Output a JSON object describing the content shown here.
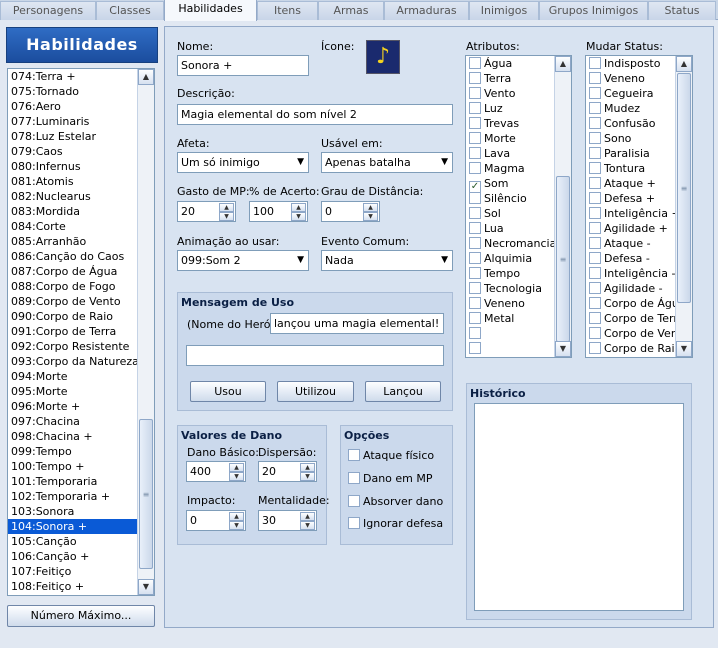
{
  "tabs": [
    "Personagens",
    "Classes",
    "Habilidades",
    "Itens",
    "Armas",
    "Armaduras",
    "Inimigos",
    "Grupos Inimigos",
    "Status"
  ],
  "active_tab": "Habilidades",
  "sidebar": {
    "title": "Habilidades",
    "items": [
      "074:Terra +",
      "075:Tornado",
      "076:Aero",
      "077:Luminaris",
      "078:Luz Estelar",
      "079:Caos",
      "080:Infernus",
      "081:Atomis",
      "082:Nuclearus",
      "083:Mordida",
      "084:Corte",
      "085:Arranhão",
      "086:Canção do Caos",
      "087:Corpo de Água",
      "088:Corpo de Fogo",
      "089:Corpo de Vento",
      "090:Corpo de Raio",
      "091:Corpo de Terra",
      "092:Corpo Resistente",
      "093:Corpo da Natureza",
      "094:Morte",
      "095:Morte",
      "096:Morte +",
      "097:Chacina",
      "098:Chacina +",
      "099:Tempo",
      "100:Tempo +",
      "101:Temporaria",
      "102:Temporaria +",
      "103:Sonora",
      "104:Sonora +",
      "105:Canção",
      "106:Canção +",
      "107:Feitiço",
      "108:Feitiço +"
    ],
    "selected": "104:Sonora +",
    "max_button": "Número Máximo..."
  },
  "form": {
    "nome_label": "Nome:",
    "nome_value": "Sonora +",
    "icone_label": "Ícone:",
    "icone_glyph": "♪",
    "descricao_label": "Descrição:",
    "descricao_value": "Magia elemental do som nível 2",
    "afeta_label": "Afeta:",
    "afeta_value": "Um só inimigo",
    "usavel_label": "Usável em:",
    "usavel_value": "Apenas batalha",
    "gasto_label": "Gasto de MP:",
    "gasto_value": "20",
    "acerto_label": "% de Acerto:",
    "acerto_value": "100",
    "distancia_label": "Grau de Distância:",
    "distancia_value": "0",
    "animacao_label": "Animação ao usar:",
    "animacao_value": "099:Som 2",
    "evento_label": "Evento Comum:",
    "evento_value": "Nada"
  },
  "mensagem": {
    "title": "Mensagem de Uso",
    "hero_label": "(Nome do Herói)",
    "line1": "lançou uma magia elemental!",
    "line2": "",
    "btn_usou": "Usou",
    "btn_utilizou": "Utilizou",
    "btn_lancou": "Lançou"
  },
  "dano": {
    "title": "Valores de Dano",
    "basico_label": "Dano Básico:",
    "basico_value": "400",
    "dispersao_label": "Dispersão:",
    "dispersao_value": "20",
    "impacto_label": "Impacto:",
    "impacto_value": "0",
    "mentalidade_label": "Mentalidade:",
    "mentalidade_value": "30"
  },
  "opcoes": {
    "title": "Opções",
    "items": [
      {
        "label": "Ataque físico",
        "checked": false
      },
      {
        "label": "Dano em MP",
        "checked": false
      },
      {
        "label": "Absorver dano",
        "checked": false
      },
      {
        "label": "Ignorar defesa",
        "checked": false
      }
    ]
  },
  "atributos": {
    "label": "Atributos:",
    "items": [
      {
        "label": "Água",
        "checked": false
      },
      {
        "label": "Terra",
        "checked": false
      },
      {
        "label": "Vento",
        "checked": false
      },
      {
        "label": "Luz",
        "checked": false
      },
      {
        "label": "Trevas",
        "checked": false
      },
      {
        "label": "Morte",
        "checked": false
      },
      {
        "label": "Lava",
        "checked": false
      },
      {
        "label": "Magma",
        "checked": false
      },
      {
        "label": "Som",
        "checked": true
      },
      {
        "label": "Silêncio",
        "checked": false
      },
      {
        "label": "Sol",
        "checked": false
      },
      {
        "label": "Lua",
        "checked": false
      },
      {
        "label": "Necromancia",
        "checked": false
      },
      {
        "label": "Alquimia",
        "checked": false
      },
      {
        "label": "Tempo",
        "checked": false
      },
      {
        "label": "Tecnologia",
        "checked": false
      },
      {
        "label": "Veneno",
        "checked": false
      },
      {
        "label": "Metal",
        "checked": false
      },
      {
        "label": "",
        "checked": false
      },
      {
        "label": "",
        "checked": false
      }
    ]
  },
  "status": {
    "label": "Mudar Status:",
    "items": [
      "Indisposto",
      "Veneno",
      "Cegueira",
      "Mudez",
      "Confusão",
      "Sono",
      "Paralisia",
      "Tontura",
      "Ataque +",
      "Defesa +",
      "Inteligência +",
      "Agilidade +",
      "Ataque -",
      "Defesa -",
      "Inteligência -",
      "Agilidade -",
      "Corpo de Água",
      "Corpo de Terra",
      "Corpo de Vento",
      "Corpo de Raio"
    ]
  },
  "historico": {
    "title": "Histórico",
    "text": ""
  }
}
